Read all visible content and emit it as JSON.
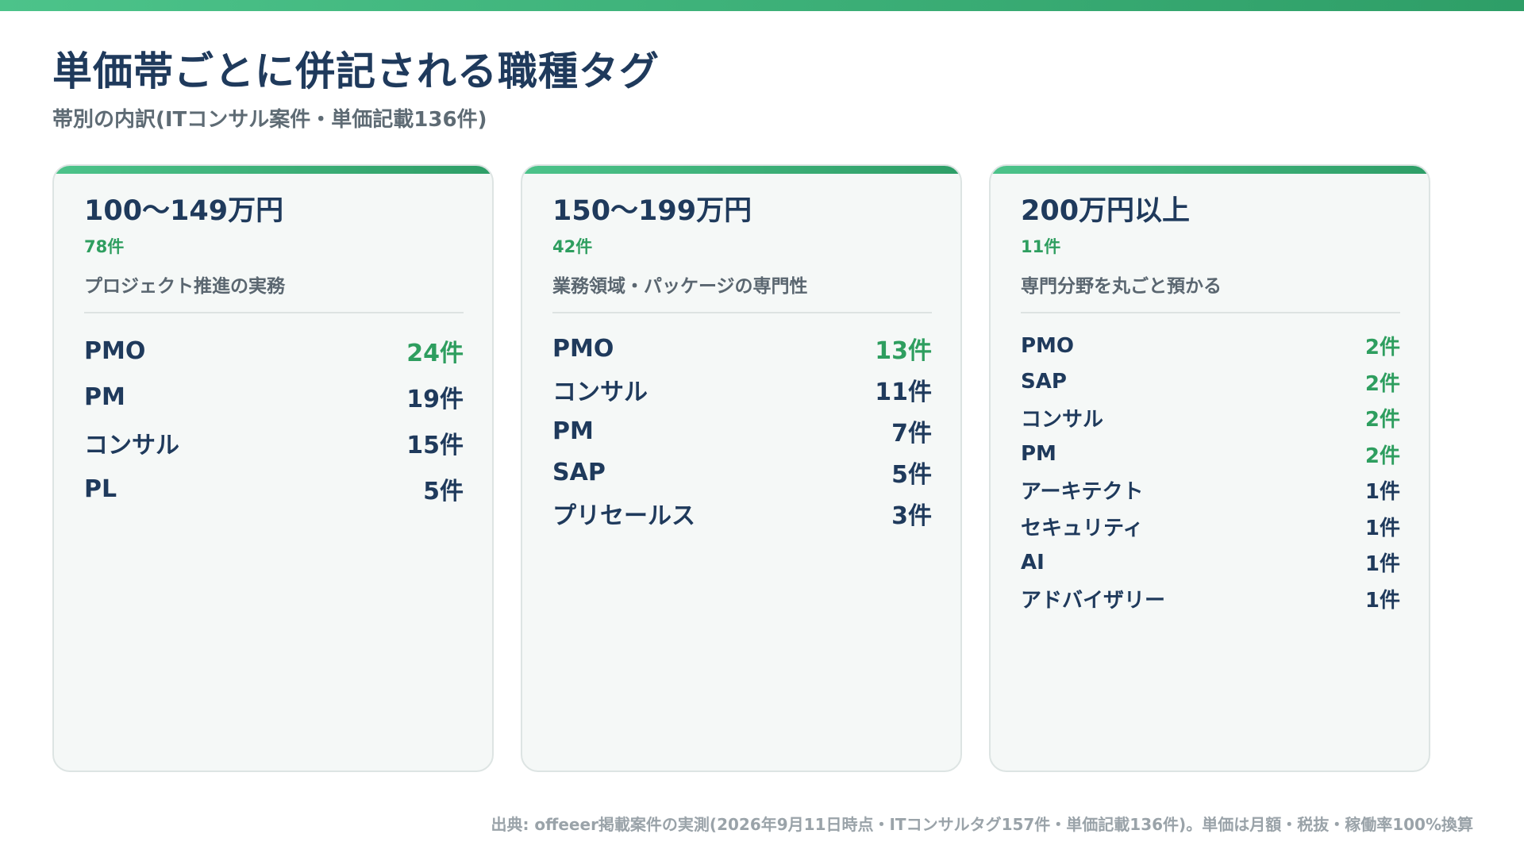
{
  "colors": {
    "accent": "#3fb47a",
    "highlight": "#2e9e5f",
    "title": "#1f3a5c",
    "card_bg": "#f5f8f7"
  },
  "header": {
    "title": "単価帯ごとに併記される職種タグ",
    "subtitle": "帯別の内訳(ITコンサル案件・単価記載136件)"
  },
  "cards": [
    {
      "band": "100〜149万円",
      "count": "78件",
      "description": "プロジェクト推進の実務",
      "rows": [
        {
          "label": "PMO",
          "value": "24件",
          "highlight": true
        },
        {
          "label": "PM",
          "value": "19件",
          "highlight": false
        },
        {
          "label": "コンサル",
          "value": "15件",
          "highlight": false
        },
        {
          "label": "PL",
          "value": "5件",
          "highlight": false
        }
      ]
    },
    {
      "band": "150〜199万円",
      "count": "42件",
      "description": "業務領域・パッケージの専門性",
      "rows": [
        {
          "label": "PMO",
          "value": "13件",
          "highlight": true
        },
        {
          "label": "コンサル",
          "value": "11件",
          "highlight": false
        },
        {
          "label": "PM",
          "value": "7件",
          "highlight": false
        },
        {
          "label": "SAP",
          "value": "5件",
          "highlight": false
        },
        {
          "label": "プリセールス",
          "value": "3件",
          "highlight": false
        }
      ]
    },
    {
      "band": "200万円以上",
      "count": "11件",
      "description": "専門分野を丸ごと預かる",
      "rows": [
        {
          "label": "PMO",
          "value": "2件",
          "highlight": true
        },
        {
          "label": "SAP",
          "value": "2件",
          "highlight": true
        },
        {
          "label": "コンサル",
          "value": "2件",
          "highlight": true
        },
        {
          "label": "PM",
          "value": "2件",
          "highlight": true
        },
        {
          "label": "アーキテクト",
          "value": "1件",
          "highlight": false
        },
        {
          "label": "セキュリティ",
          "value": "1件",
          "highlight": false
        },
        {
          "label": "AI",
          "value": "1件",
          "highlight": false
        },
        {
          "label": "アドバイザリー",
          "value": "1件",
          "highlight": false
        }
      ]
    }
  ],
  "footer": {
    "source": "出典: offeeer掲載案件の実測(2026年9月11日時点・ITコンサルタグ157件・単価記載136件)。単価は月額・税抜・稼働率100%換算"
  }
}
